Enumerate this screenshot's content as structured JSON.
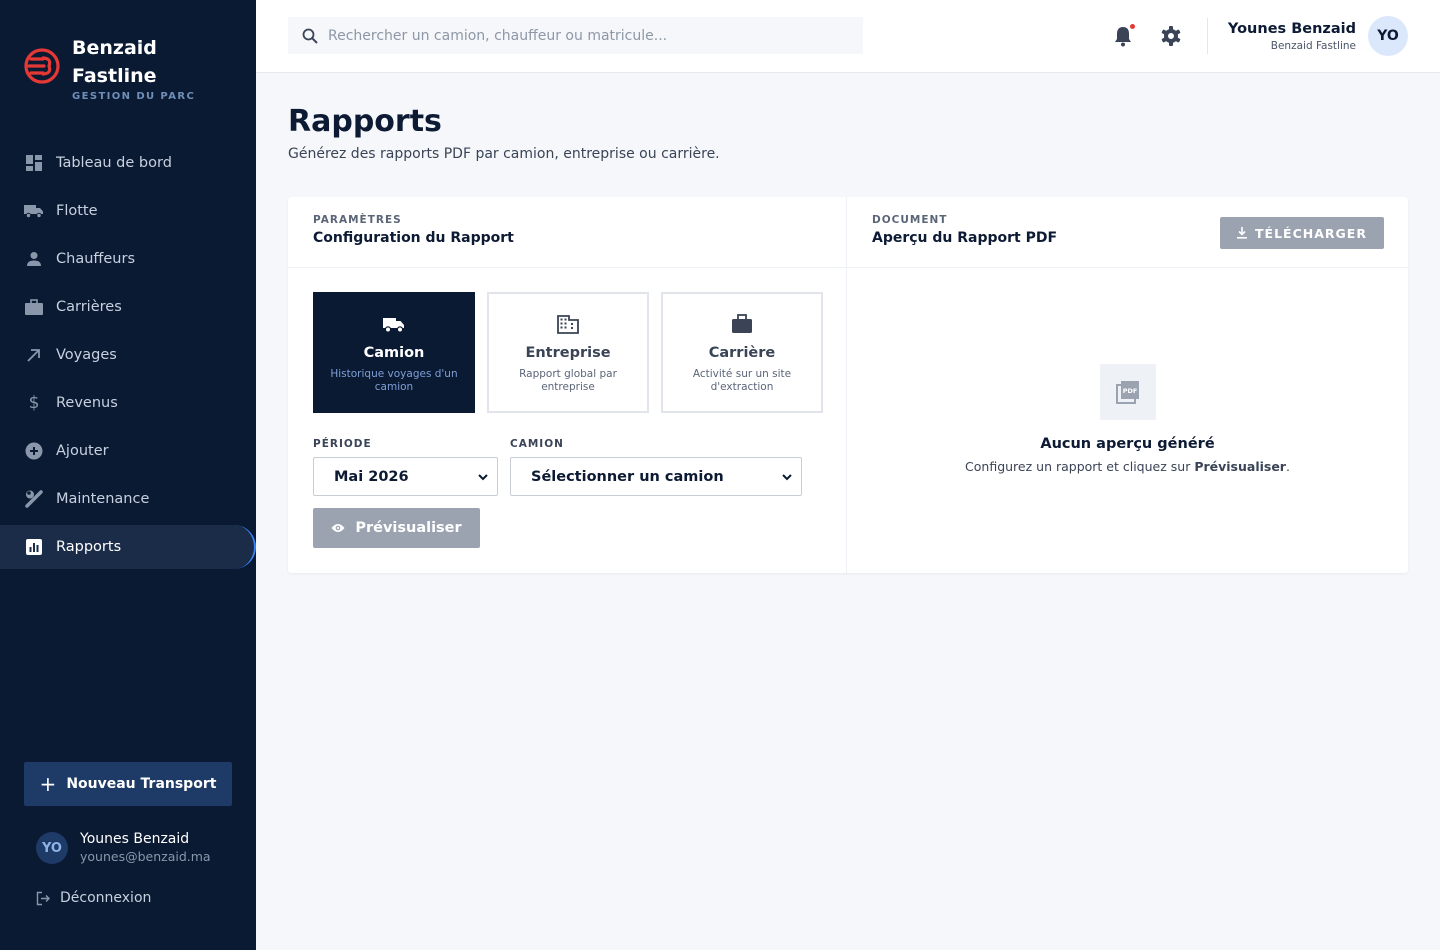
{
  "brand": {
    "name": "Benzaid Fastline",
    "subtitle": "GESTION DU PARC",
    "logo_color": "#e53935"
  },
  "sidebar": {
    "items": [
      {
        "label": "Tableau de bord",
        "icon": "dashboard-icon"
      },
      {
        "label": "Flotte",
        "icon": "truck-icon"
      },
      {
        "label": "Chauffeurs",
        "icon": "person-icon"
      },
      {
        "label": "Carrières",
        "icon": "briefcase-icon"
      },
      {
        "label": "Voyages",
        "icon": "arrow-up-right-icon"
      },
      {
        "label": "Revenus",
        "icon": "dollar-icon"
      },
      {
        "label": "Ajouter",
        "icon": "add-circle-icon"
      },
      {
        "label": "Maintenance",
        "icon": "wrench-icon"
      },
      {
        "label": "Rapports",
        "icon": "bar-chart-icon",
        "active": true
      }
    ],
    "new_button": "Nouveau Transport",
    "user": {
      "initials": "YO",
      "name": "Younes Benzaid",
      "email": "younes@benzaid.ma"
    },
    "logout": "Déconnexion"
  },
  "topbar": {
    "search_placeholder": "Rechercher un camion, chauffeur ou matricule...",
    "user_name": "Younes Benzaid",
    "user_org": "Benzaid Fastline",
    "avatar_initials": "YO"
  },
  "page": {
    "title": "Rapports",
    "subtitle": "Générez des rapports PDF par camion, entreprise ou carrière."
  },
  "config": {
    "eyebrow": "PARAMÈTRES",
    "title": "Configuration du Rapport",
    "types": [
      {
        "name": "Camion",
        "desc": "Historique voyages d'un camion",
        "icon": "truck-icon",
        "active": true
      },
      {
        "name": "Entreprise",
        "desc": "Rapport global par entreprise",
        "icon": "building-icon",
        "active": false
      },
      {
        "name": "Carrière",
        "desc": "Activité sur un site d'extraction",
        "icon": "briefcase-icon",
        "active": false
      }
    ],
    "period_label": "PÉRIODE",
    "period_value": "Mai 2026",
    "truck_label": "CAMION",
    "truck_value": "Sélectionner un camion",
    "preview_button": "Prévisualiser"
  },
  "document": {
    "eyebrow": "DOCUMENT",
    "title": "Aperçu du Rapport PDF",
    "download_button": "TÉLÉCHARGER",
    "empty_title": "Aucun aperçu généré",
    "empty_sub_prefix": "Configurez un rapport et cliquez sur ",
    "empty_sub_strong": "Prévisualiser",
    "empty_sub_suffix": "."
  },
  "colors": {
    "sidebar_bg": "#0b1a33",
    "accent": "#3b82f6",
    "disabled": "#9aa3af"
  }
}
